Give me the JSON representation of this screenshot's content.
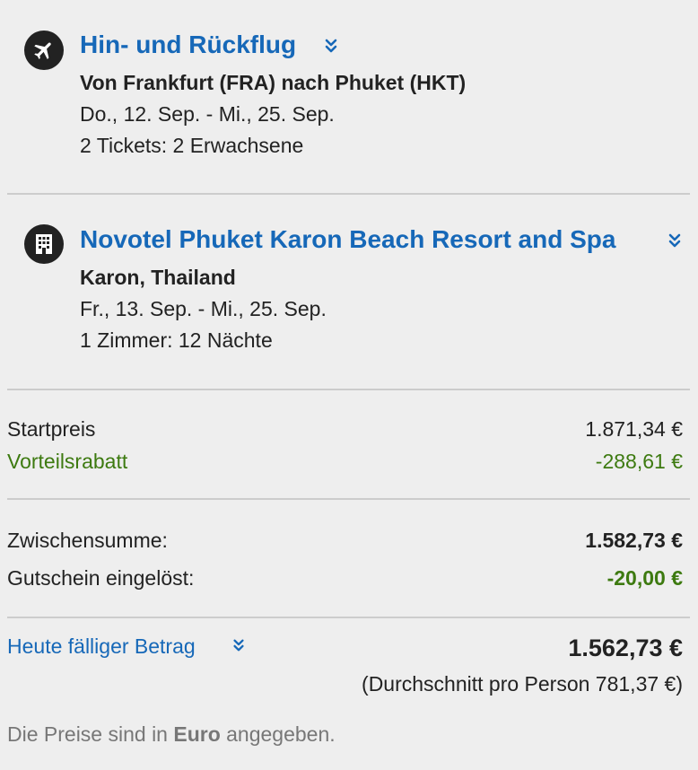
{
  "flight": {
    "icon": "airplane-icon",
    "title": "Hin- und Rückflug",
    "route": "Von Frankfurt (FRA) nach Phuket (HKT)",
    "dates": "Do., 12. Sep. - Mi., 25. Sep.",
    "tickets": "2 Tickets: 2 Erwachsene"
  },
  "hotel": {
    "icon": "building-icon",
    "title": "Novotel Phuket Karon Beach Resort and Spa",
    "location": "Karon, Thailand",
    "dates": "Fr., 13. Sep. - Mi., 25. Sep.",
    "rooms": "1 Zimmer: 12 Nächte"
  },
  "pricing": {
    "start_label": "Startpreis",
    "start_value": "1.871,34 €",
    "discount_label": "Vorteilsrabatt",
    "discount_value": "-288,61 €",
    "subtotal_label": "Zwischensumme:",
    "subtotal_value": "1.582,73 €",
    "voucher_label": "Gutschein eingelöst:",
    "voucher_value": "-20,00 €",
    "due_label": "Heute fälliger Betrag",
    "due_value": "1.562,73 €",
    "average": "(Durchschnitt pro Person 781,37 €)"
  },
  "footer": {
    "note_prefix": "Die Preise sind in ",
    "note_currency": "Euro",
    "note_suffix": " angegeben."
  },
  "colors": {
    "link": "#1668b8",
    "discount": "#3d7a10",
    "background": "#eeeeee",
    "divider": "#cccccc"
  }
}
